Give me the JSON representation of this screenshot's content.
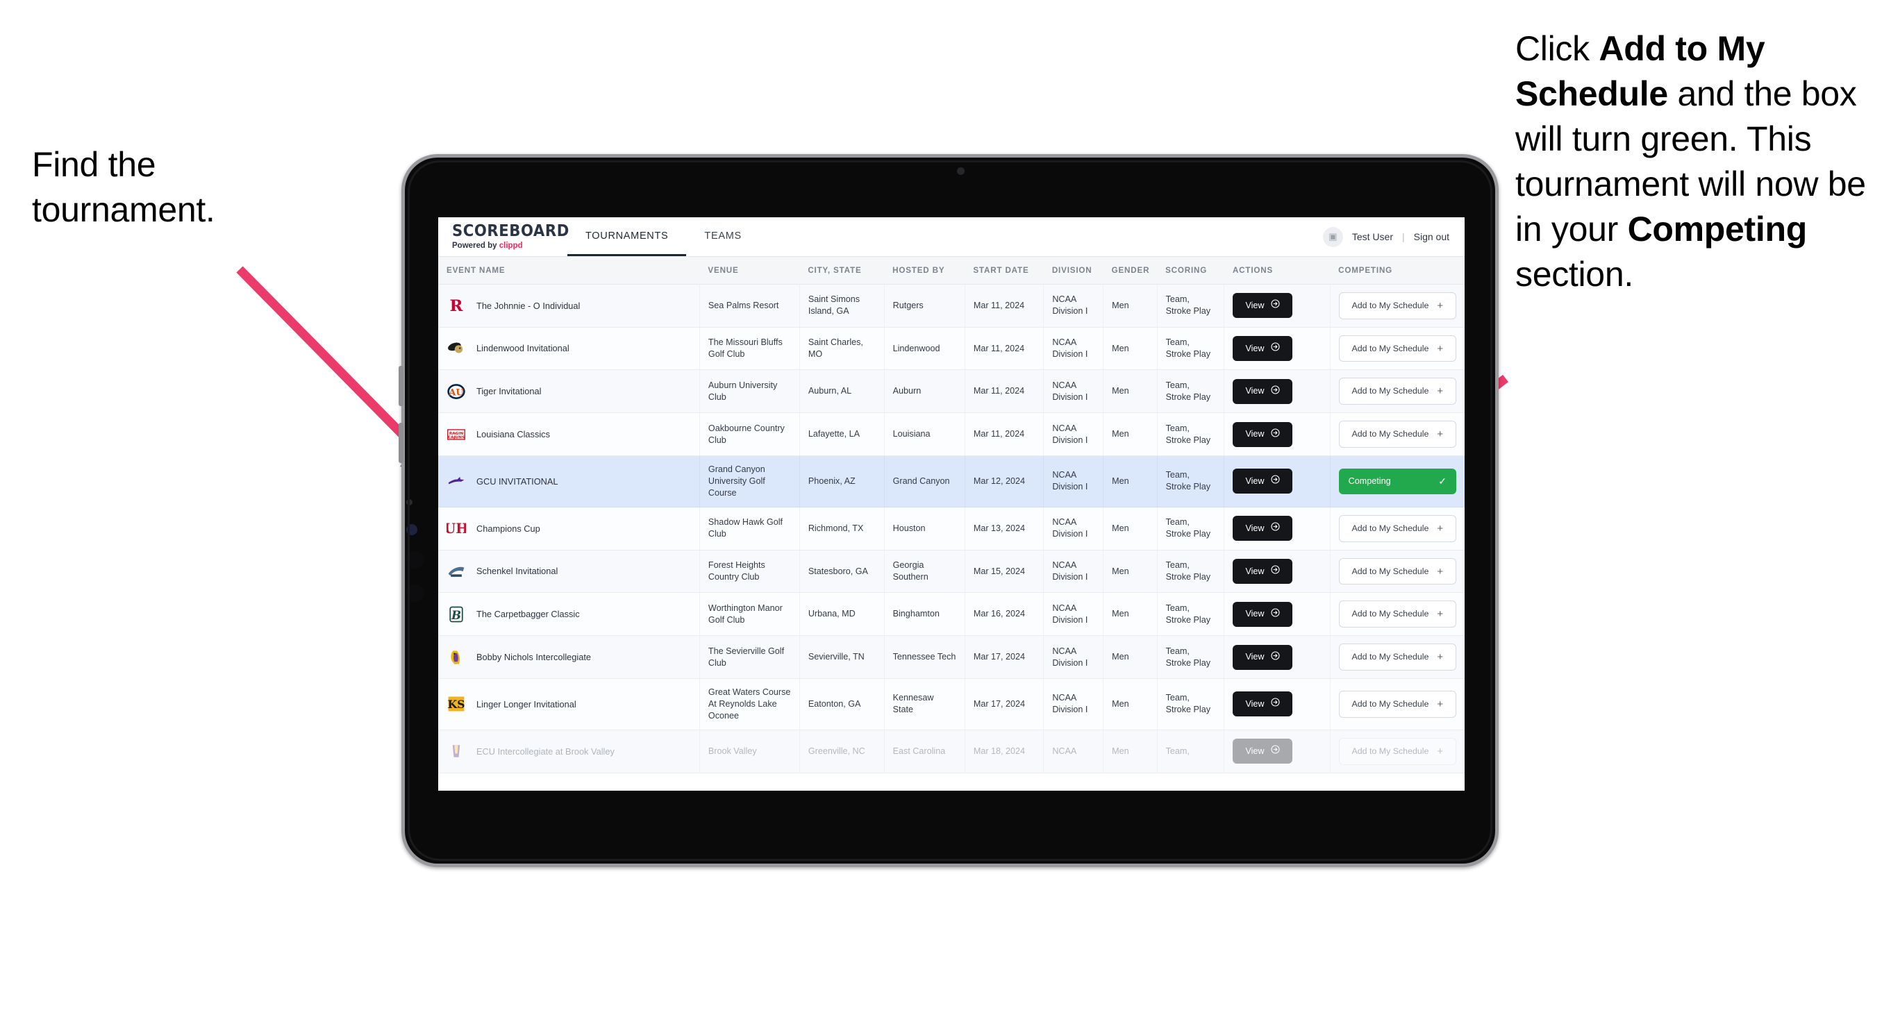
{
  "annotations": {
    "left": "Find the tournament.",
    "right_parts": [
      {
        "text": "Click ",
        "bold": false
      },
      {
        "text": "Add to My Schedule",
        "bold": true
      },
      {
        "text": " and the box will turn green. This tournament will now be in your ",
        "bold": false
      },
      {
        "text": "Competing",
        "bold": true
      },
      {
        "text": " section.",
        "bold": false
      }
    ],
    "arrow_color": "#ea3b6b"
  },
  "app": {
    "brand": {
      "title": "SCOREBOARD",
      "powered_prefix": "Powered by ",
      "powered_brand": "clippd"
    },
    "tabs": [
      {
        "label": "TOURNAMENTS",
        "active": true
      },
      {
        "label": "TEAMS",
        "active": false
      }
    ],
    "user": {
      "name": "Test User",
      "separator": "|",
      "sign_out": "Sign out"
    },
    "table": {
      "columns": [
        "EVENT NAME",
        "VENUE",
        "CITY, STATE",
        "HOSTED BY",
        "START DATE",
        "DIVISION",
        "GENDER",
        "SCORING",
        "ACTIONS",
        "COMPETING"
      ],
      "view_label": "View",
      "add_label": "Add to My Schedule",
      "competing_label": "Competing",
      "rows": [
        {
          "event": "The Johnnie - O Individual",
          "venue": "Sea Palms Resort",
          "city": "Saint Simons Island, GA",
          "host": "Rutgers",
          "date": "Mar 11, 2024",
          "division": "NCAA Division I",
          "gender": "Men",
          "scoring": "Team, Stroke Play",
          "competing": false,
          "logo": "rutgers"
        },
        {
          "event": "Lindenwood Invitational",
          "venue": "The Missouri Bluffs Golf Club",
          "city": "Saint Charles, MO",
          "host": "Lindenwood",
          "date": "Mar 11, 2024",
          "division": "NCAA Division I",
          "gender": "Men",
          "scoring": "Team, Stroke Play",
          "competing": false,
          "logo": "lindenwood"
        },
        {
          "event": "Tiger Invitational",
          "venue": "Auburn University Club",
          "city": "Auburn, AL",
          "host": "Auburn",
          "date": "Mar 11, 2024",
          "division": "NCAA Division I",
          "gender": "Men",
          "scoring": "Team, Stroke Play",
          "competing": false,
          "logo": "auburn"
        },
        {
          "event": "Louisiana Classics",
          "venue": "Oakbourne Country Club",
          "city": "Lafayette, LA",
          "host": "Louisiana",
          "date": "Mar 11, 2024",
          "division": "NCAA Division I",
          "gender": "Men",
          "scoring": "Team, Stroke Play",
          "competing": false,
          "logo": "cajuns"
        },
        {
          "event": "GCU INVITATIONAL",
          "venue": "Grand Canyon University Golf Course",
          "city": "Phoenix, AZ",
          "host": "Grand Canyon",
          "date": "Mar 12, 2024",
          "division": "NCAA Division I",
          "gender": "Men",
          "scoring": "Team, Stroke Play",
          "competing": true,
          "logo": "gcu"
        },
        {
          "event": "Champions Cup",
          "venue": "Shadow Hawk Golf Club",
          "city": "Richmond, TX",
          "host": "Houston",
          "date": "Mar 13, 2024",
          "division": "NCAA Division I",
          "gender": "Men",
          "scoring": "Team, Stroke Play",
          "competing": false,
          "logo": "houston"
        },
        {
          "event": "Schenkel Invitational",
          "venue": "Forest Heights Country Club",
          "city": "Statesboro, GA",
          "host": "Georgia Southern",
          "date": "Mar 15, 2024",
          "division": "NCAA Division I",
          "gender": "Men",
          "scoring": "Team, Stroke Play",
          "competing": false,
          "logo": "gasouthern"
        },
        {
          "event": "The Carpetbagger Classic",
          "venue": "Worthington Manor Golf Club",
          "city": "Urbana, MD",
          "host": "Binghamton",
          "date": "Mar 16, 2024",
          "division": "NCAA Division I",
          "gender": "Men",
          "scoring": "Team, Stroke Play",
          "competing": false,
          "logo": "binghamton"
        },
        {
          "event": "Bobby Nichols Intercollegiate",
          "venue": "The Sevierville Golf Club",
          "city": "Sevierville, TN",
          "host": "Tennessee Tech",
          "date": "Mar 17, 2024",
          "division": "NCAA Division I",
          "gender": "Men",
          "scoring": "Team, Stroke Play",
          "competing": false,
          "logo": "tntech"
        },
        {
          "event": "Linger Longer Invitational",
          "venue": "Great Waters Course At Reynolds Lake Oconee",
          "city": "Eatonton, GA",
          "host": "Kennesaw State",
          "date": "Mar 17, 2024",
          "division": "NCAA Division I",
          "gender": "Men",
          "scoring": "Team, Stroke Play",
          "competing": false,
          "logo": "kennesaw"
        },
        {
          "event": "ECU Intercollegiate at Brook Valley",
          "venue": "Brook Valley",
          "city": "Greenville, NC",
          "host": "East Carolina",
          "date": "Mar 18, 2024",
          "division": "NCAA",
          "gender": "Men",
          "scoring": "Team,",
          "competing": false,
          "logo": "ecu",
          "cut": true
        }
      ]
    }
  }
}
